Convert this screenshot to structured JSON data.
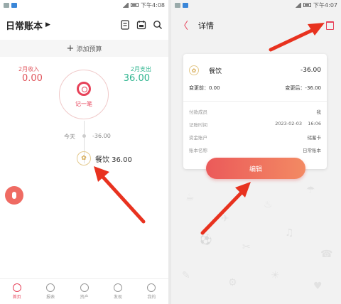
{
  "left": {
    "status_time": "下午4:08",
    "title": "日常账本",
    "caret": "▶",
    "add_budget": "添加预算",
    "income_label": "2月收入",
    "income_value": "0.00",
    "expense_label": "2月支出",
    "expense_value": "36.00",
    "record_label": "记一笔",
    "today_label": "今天",
    "today_value": "-36.00",
    "entry_text": "餐饮 36.00",
    "tabs": [
      {
        "label": "首页"
      },
      {
        "label": "报表"
      },
      {
        "label": "资产"
      },
      {
        "label": "发现"
      },
      {
        "label": "我的"
      }
    ]
  },
  "right": {
    "status_time": "下午4:07",
    "back": "〈",
    "title": "详情",
    "category": "餐饮",
    "amount": "-36.00",
    "before_label": "变更前：0.00",
    "after_label": "变更后：-36.00",
    "rows": [
      {
        "key": "付款成员",
        "value": "我"
      },
      {
        "key": "记账时间",
        "value": "2023-02-03    16:06"
      },
      {
        "key": "资金账户",
        "value": "储蓄卡"
      },
      {
        "key": "账本名称",
        "value": "日常账本"
      }
    ],
    "edit_label": "编辑"
  },
  "colors": {
    "accent": "#e7435a",
    "income": "#e0555c",
    "expense": "#2fb58f",
    "arrow": "#e8321f"
  }
}
